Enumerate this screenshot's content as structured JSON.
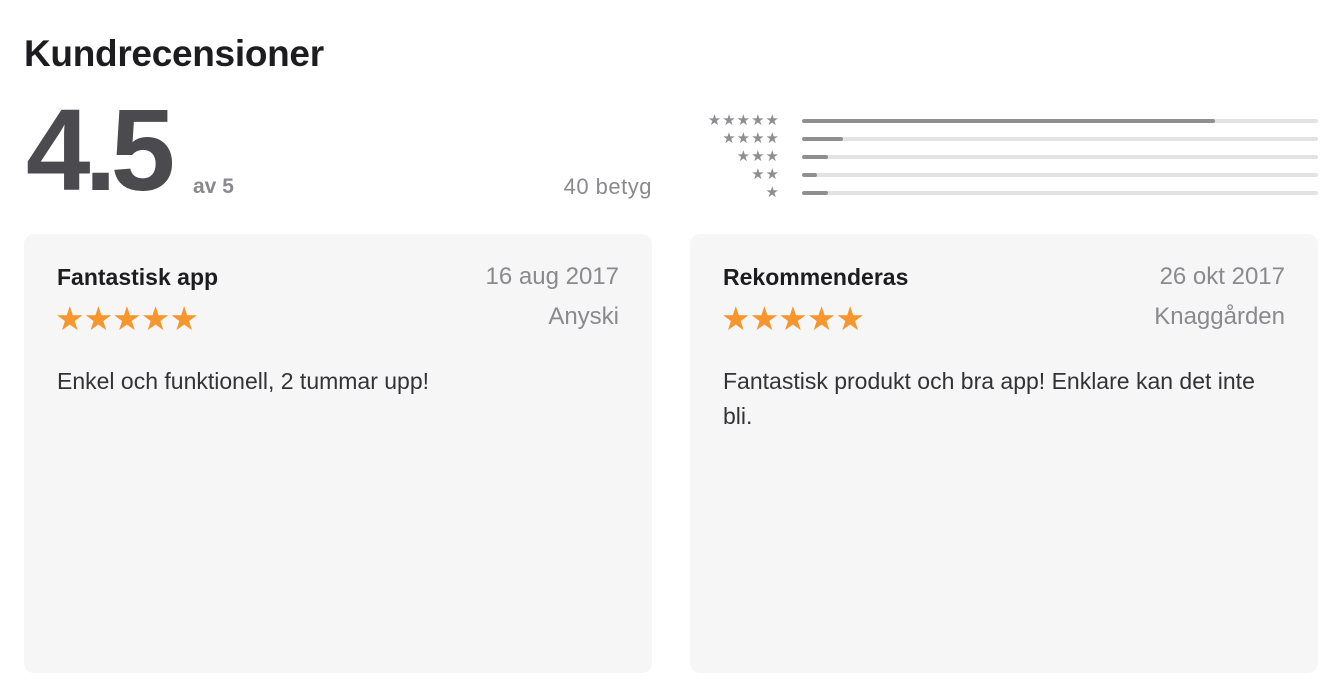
{
  "section": {
    "title": "Kundrecensioner"
  },
  "summary": {
    "average": "4.5",
    "out_of": "av 5",
    "ratings_count": "40 betyg"
  },
  "histogram": {
    "rows": [
      {
        "stars_label": "★★★★★",
        "star_count": 5,
        "fraction": 0.8
      },
      {
        "stars_label": "★★★★",
        "star_count": 4,
        "fraction": 0.08
      },
      {
        "stars_label": "★★★",
        "star_count": 3,
        "fraction": 0.05
      },
      {
        "stars_label": "★★",
        "star_count": 2,
        "fraction": 0.03
      },
      {
        "stars_label": "★",
        "star_count": 1,
        "fraction": 0.05
      }
    ]
  },
  "reviews": [
    {
      "title": "Fantastisk app",
      "date": "16 aug 2017",
      "stars": "★★★★★",
      "rating": 5,
      "author": "Anyski",
      "body": "Enkel och funktionell, 2 tummar upp!"
    },
    {
      "title": "Rekommenderas",
      "date": "26 okt 2017",
      "stars": "★★★★★",
      "rating": 5,
      "author": "Knaggården",
      "body": "Fantastisk produkt och bra app! Enklare kan det inte bli."
    }
  ],
  "colors": {
    "star_orange": "#f6962c",
    "rating_gray": "#4a4a4f",
    "card_background": "#f6f6f7",
    "bar_fill": "#8e8e93",
    "bar_track": "#e3e3e6"
  }
}
